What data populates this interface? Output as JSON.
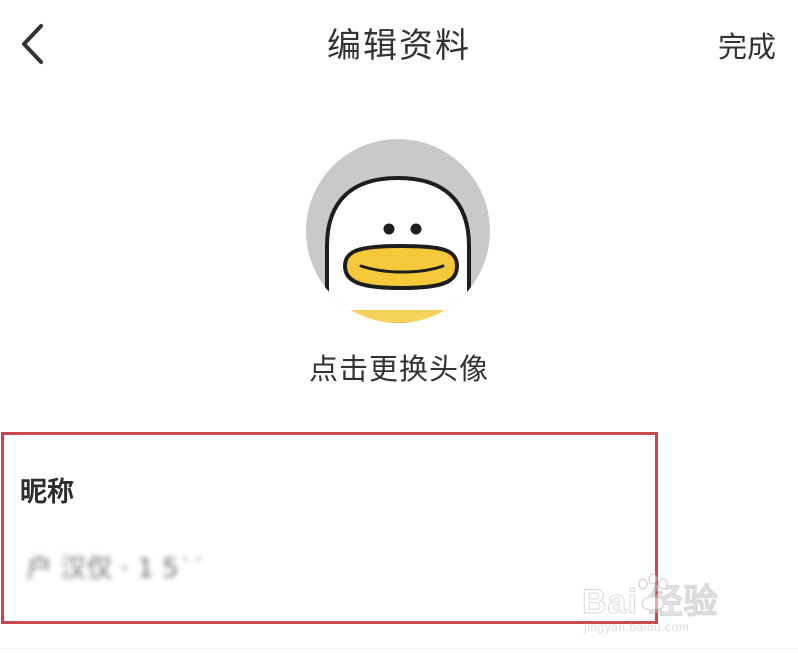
{
  "header": {
    "back_icon": "chevron-left-icon",
    "title": "编辑资料",
    "done_label": "完成"
  },
  "avatar": {
    "icon": "duck-face-avatar",
    "caption": "点击更换头像",
    "colors": {
      "background": "#c9c9c9",
      "face": "#ffffff",
      "beak": "#f5c93a",
      "outline": "#1e1e1e"
    }
  },
  "nickname": {
    "label": "昵称",
    "value": " 户 汉仅 · 1 5˙˙"
  },
  "highlight": {
    "color": "#c9474f"
  },
  "watermark": {
    "logo": "Bai  经验",
    "url": "jingyan.baidu.com"
  }
}
